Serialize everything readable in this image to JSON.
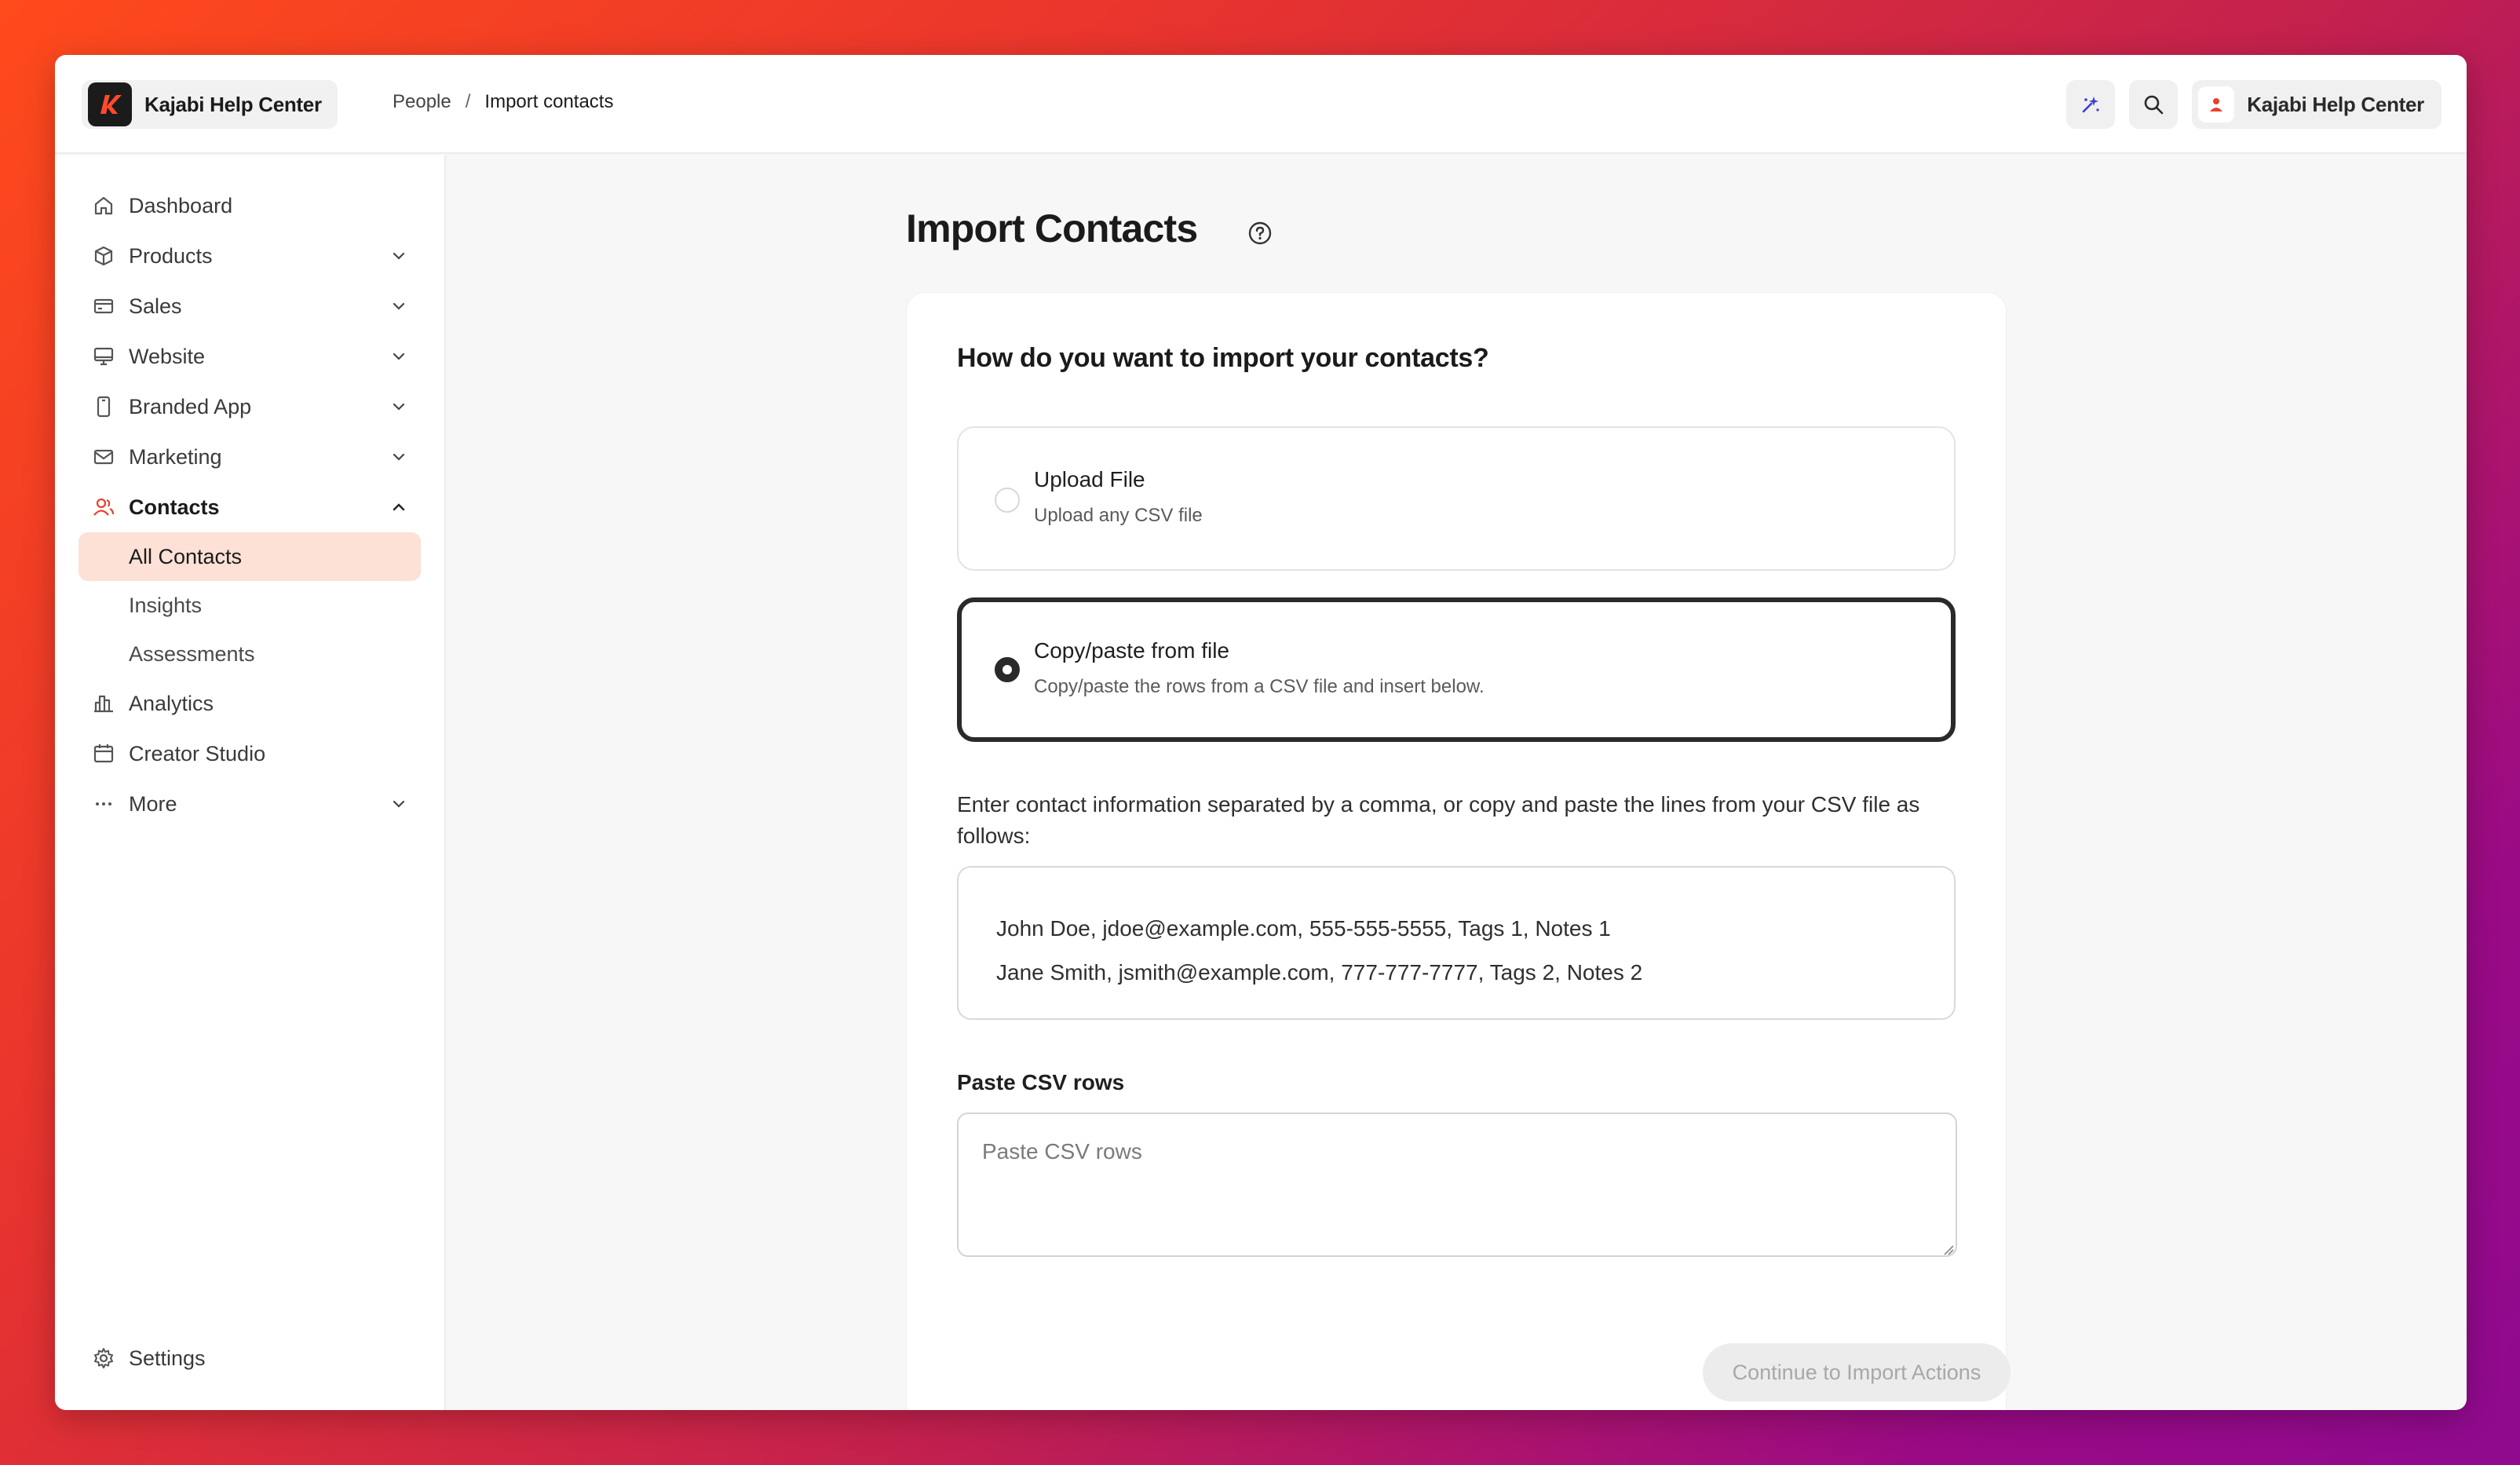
{
  "brand": {
    "name": "Kajabi Help Center",
    "logo_icon": "kajabi-k-logo"
  },
  "breadcrumb": {
    "parent": "People",
    "separator": "/",
    "current": "Import contacts"
  },
  "header": {
    "account_name": "Kajabi Help Center",
    "accent": "#e8412c"
  },
  "sidebar": {
    "items": [
      {
        "label": "Dashboard",
        "icon": "home-icon",
        "expandable": false
      },
      {
        "label": "Products",
        "icon": "box-icon",
        "expandable": true
      },
      {
        "label": "Sales",
        "icon": "credit-card-icon",
        "expandable": true
      },
      {
        "label": "Website",
        "icon": "monitor-icon",
        "expandable": true
      },
      {
        "label": "Branded App",
        "icon": "phone-icon",
        "expandable": true
      },
      {
        "label": "Marketing",
        "icon": "mail-icon",
        "expandable": true
      },
      {
        "label": "Contacts",
        "icon": "users-icon",
        "expandable": true,
        "expanded": true
      }
    ],
    "contacts_sub": [
      "All Contacts",
      "Insights",
      "Assessments"
    ],
    "after": [
      {
        "label": "Analytics",
        "icon": "bar-chart-icon"
      },
      {
        "label": "Creator Studio",
        "icon": "calendar-icon"
      },
      {
        "label": "More",
        "icon": "ellipsis-icon"
      }
    ],
    "settings": "Settings",
    "selected_bg": "#fde1d6"
  },
  "main": {
    "title": "Import Contacts",
    "question": "How do you want to import your contacts?",
    "options": [
      {
        "title": "Upload File",
        "subtitle": "Upload any CSV file",
        "selected": false
      },
      {
        "title": "Copy/paste from file",
        "subtitle": "Copy/paste the rows from a CSV file and insert below.",
        "selected": true
      }
    ],
    "instructions": "Enter contact information separated by a comma, or copy and paste the lines from your CSV file as follows:",
    "example_lines": [
      "John Doe, jdoe@example.com, 555-555-5555, Tags 1, Notes 1",
      "Jane Smith, jsmith@example.com, 777-777-7777, Tags 2, Notes 2"
    ],
    "paste_label": "Paste CSV rows",
    "paste_placeholder": "Paste CSV rows",
    "continue_label": "Continue to Import Actions"
  }
}
